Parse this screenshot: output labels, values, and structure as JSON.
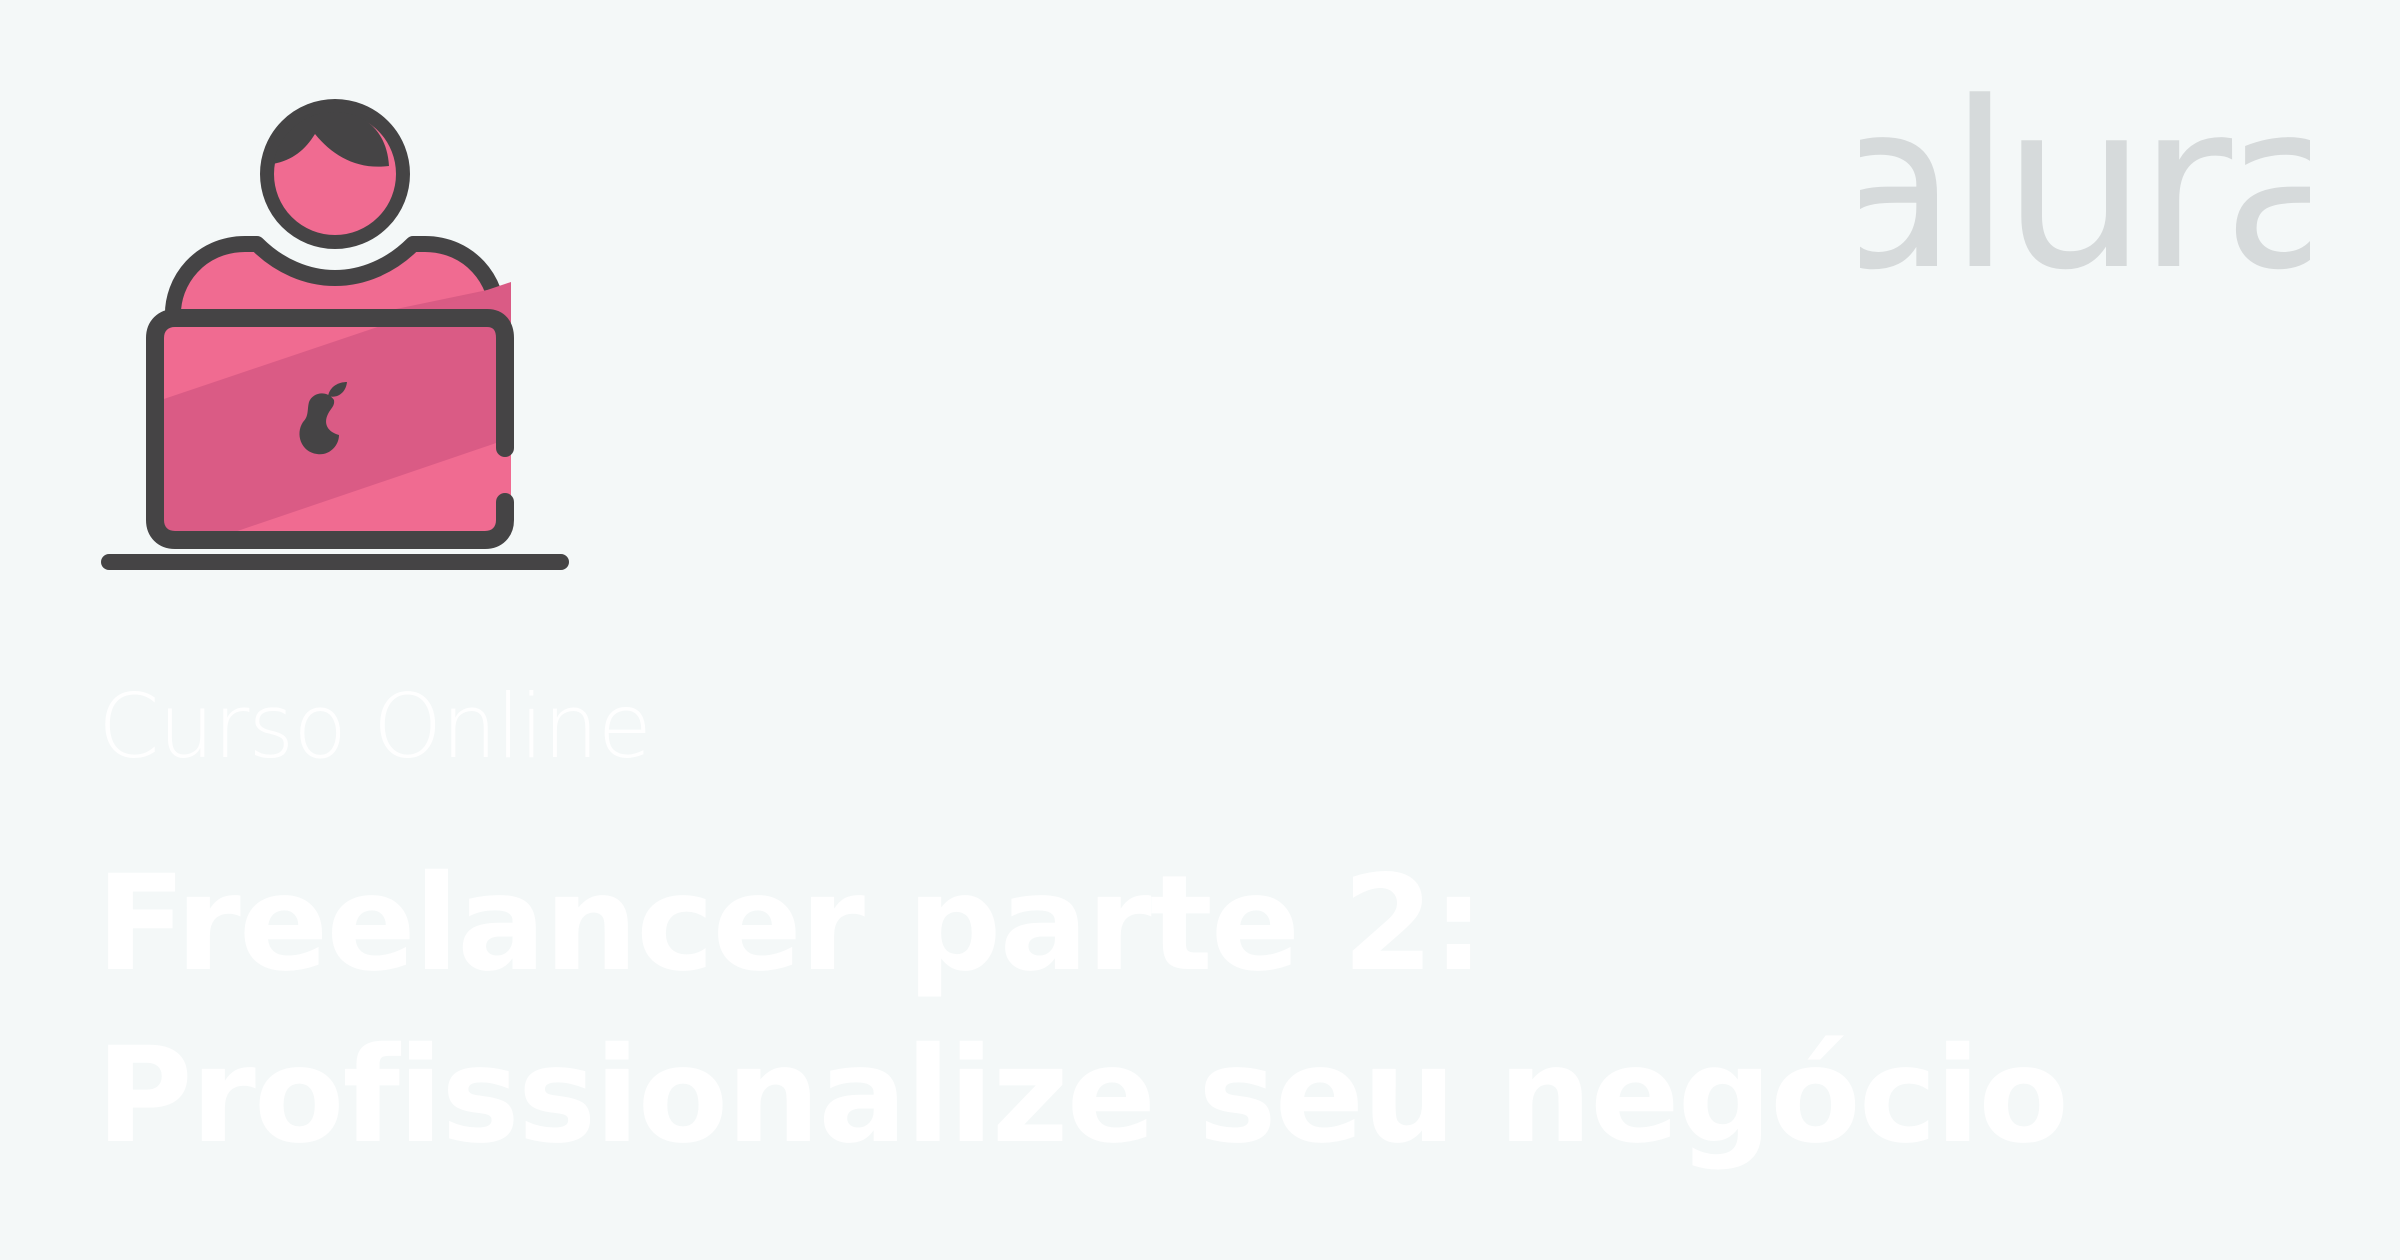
{
  "brand": {
    "name": "alura",
    "logo_color": "#d6dadb"
  },
  "course": {
    "kicker": "Curso Online",
    "title_line_1": "Freelancer parte 2:",
    "title_line_2": "Profissionalize seu negócio"
  },
  "illustration": {
    "icon": "person-with-laptop-icon",
    "accent_color": "#f06b91",
    "outline_color": "#454445"
  },
  "colors": {
    "background": "#f4f8f8",
    "text": "#ffffff"
  }
}
